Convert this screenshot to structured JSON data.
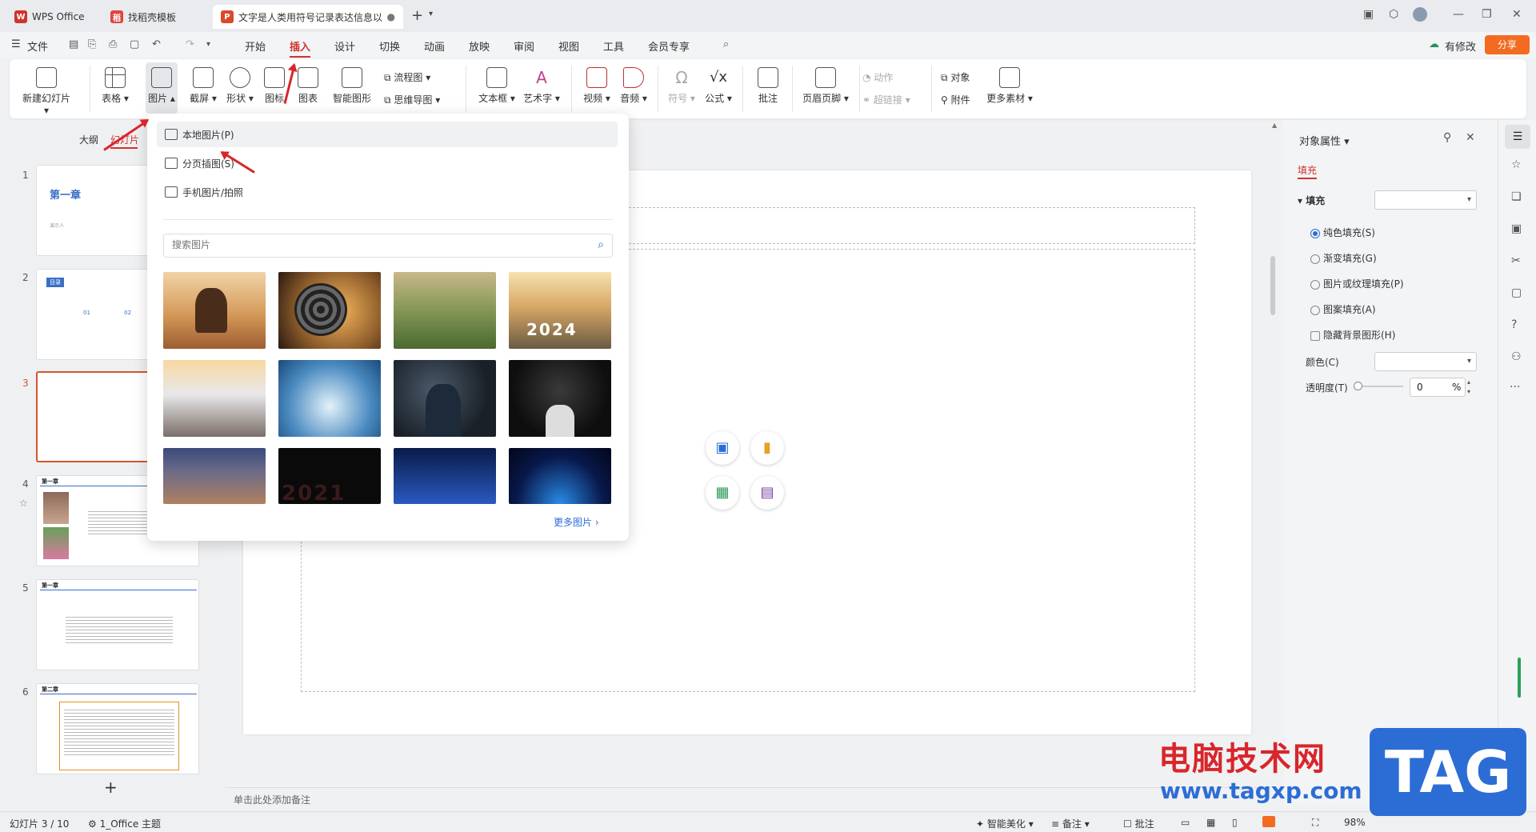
{
  "tabs": [
    {
      "label": "WPS Office"
    },
    {
      "label": "找稻壳模板"
    },
    {
      "label": "文字是人类用符号记录表达信息以…"
    }
  ],
  "menu": {
    "file": "文件",
    "items": [
      "开始",
      "插入",
      "设计",
      "切换",
      "动画",
      "放映",
      "审阅",
      "视图",
      "工具",
      "会员专享"
    ],
    "active_index": 1,
    "has_changes": "有修改",
    "share": "分享"
  },
  "ribbon": {
    "new_slide": "新建幻灯片",
    "table": "表格",
    "picture": "图片",
    "screenshot": "截屏",
    "shape": "形状",
    "icon": "图标",
    "chart": "图表",
    "smart_graphic": "智能图形",
    "flowchart": "流程图",
    "mindmap": "思维导图",
    "textbox": "文本框",
    "wordart": "艺术字",
    "video": "视频",
    "audio": "音频",
    "symbol": "符号",
    "formula": "公式",
    "comment": "批注",
    "header_footer": "页眉页脚",
    "action": "动作",
    "hyperlink": "超链接",
    "object": "对象",
    "attachment": "附件",
    "more_material": "更多素材"
  },
  "left_panel": {
    "tab_outline": "大纲",
    "tab_slides": "幻灯片",
    "slides": [
      {
        "num": "1",
        "title": "第一章",
        "sub": "演示人"
      },
      {
        "num": "2",
        "title": "目录",
        "sub": "01   02"
      },
      {
        "num": "3",
        "title": "",
        "sub": ""
      },
      {
        "num": "4",
        "title": "第一章",
        "sub": ""
      },
      {
        "num": "5",
        "title": "第一章",
        "sub": ""
      },
      {
        "num": "6",
        "title": "第二章",
        "sub": ""
      }
    ],
    "selected_index": 2,
    "add_label": "+"
  },
  "dropdown": {
    "local_picture": "本地图片(P)",
    "page_picture": "分页插图(S)",
    "phone_picture": "手机图片/拍照",
    "search_placeholder": "搜索图片",
    "more_pictures": "更多图片",
    "photo_2024_text": "2024",
    "photo_2021_text": "2021"
  },
  "notes_placeholder": "单击此处添加备注",
  "right_panel": {
    "title": "对象属性",
    "tab_fill": "填充",
    "section_fill": "填充",
    "opt_solid": "纯色填充(S)",
    "opt_gradient": "渐变填充(G)",
    "opt_picture": "图片或纹理填充(P)",
    "opt_pattern": "图案填充(A)",
    "opt_hide_bg": "隐藏背景图形(H)",
    "color_label": "颜色(C)",
    "transparency_label": "透明度(T)",
    "transparency_value": "0",
    "percent": "%"
  },
  "status": {
    "slide_info": "幻灯片 3 / 10",
    "theme": "1_Office 主题",
    "beautify": "智能美化",
    "notes": "备注",
    "comments": "批注",
    "zoom": "98%"
  },
  "watermark": {
    "site_name": "电脑技术网",
    "url": "www.tagxp.com",
    "tag": "TAG"
  },
  "colors": {
    "accent": "#d0332b",
    "selected_slide_border": "#d0572e",
    "link_blue": "#2c6dd5",
    "share_orange": "#f26b21"
  }
}
